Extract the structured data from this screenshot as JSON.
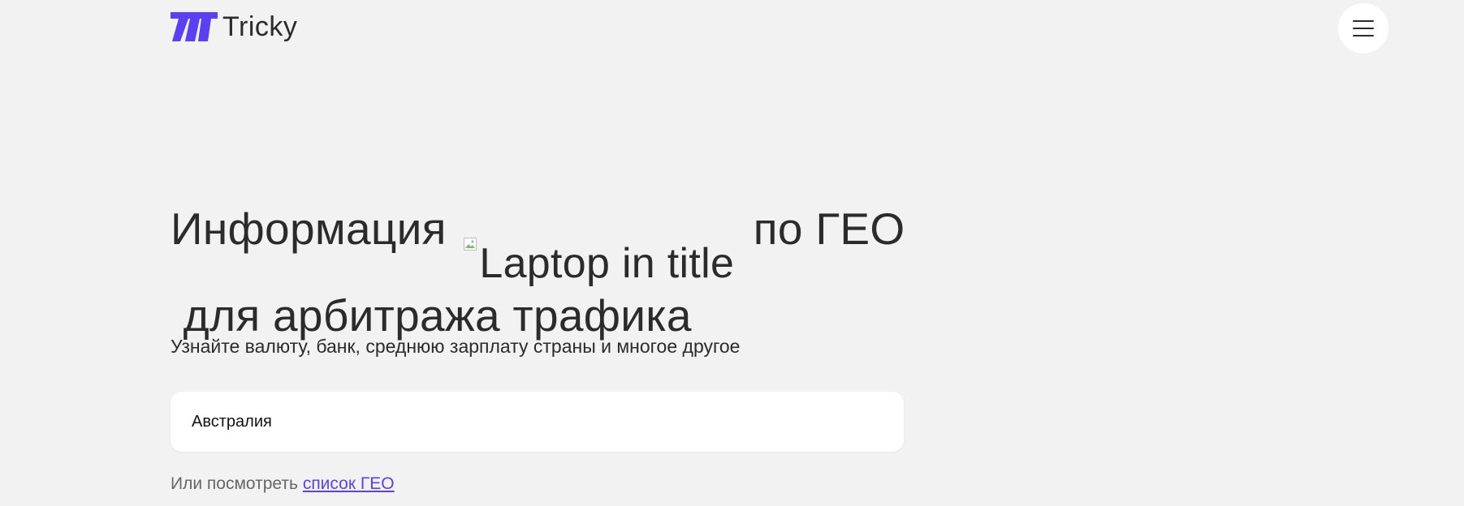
{
  "header": {
    "logo_text": "Tricky",
    "logo_icon": "tricky-logo-mark",
    "menu_icon": "hamburger-menu-icon"
  },
  "hero": {
    "title_part1": "Информация",
    "title_image_alt": "Laptop in title",
    "title_part2": "по ГЕО",
    "title_line2": "для арбитража трафика",
    "subtitle": "Узнайте валюту, банк, среднюю зарплату страны и многое другое"
  },
  "search": {
    "value": "Австралия"
  },
  "geo_list": {
    "prefix": "Или посмотреть",
    "link_label": "список ГЕО"
  },
  "colors": {
    "background": "#f2f2f2",
    "brand_purple": "#5b3ff4",
    "text": "#2b2b2b",
    "link": "#5b3ff4"
  }
}
